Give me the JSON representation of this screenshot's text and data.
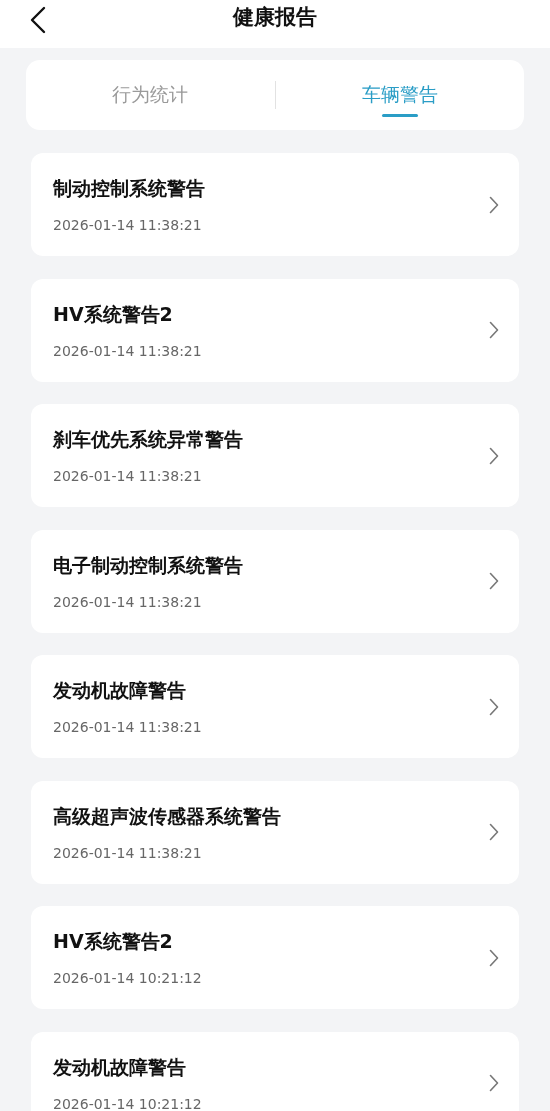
{
  "header": {
    "title": "健康报告"
  },
  "tabs": [
    {
      "label": "行为统计",
      "selected": false
    },
    {
      "label": "车辆警告",
      "selected": true
    }
  ],
  "warnings": [
    {
      "title": "制动控制系统警告",
      "time": "2026-01-14 11:38:21"
    },
    {
      "title": "HV系统警告2",
      "time": "2026-01-14 11:38:21"
    },
    {
      "title": "刹车优先系统异常警告",
      "time": "2026-01-14 11:38:21"
    },
    {
      "title": "电子制动控制系统警告",
      "time": "2026-01-14 11:38:21"
    },
    {
      "title": "发动机故障警告",
      "time": "2026-01-14 11:38:21"
    },
    {
      "title": "高级超声波传感器系统警告",
      "time": "2026-01-14 11:38:21"
    },
    {
      "title": "HV系统警告2",
      "time": "2026-01-14 10:21:12"
    },
    {
      "title": "发动机故障警告",
      "time": "2026-01-14 10:21:12"
    }
  ]
}
